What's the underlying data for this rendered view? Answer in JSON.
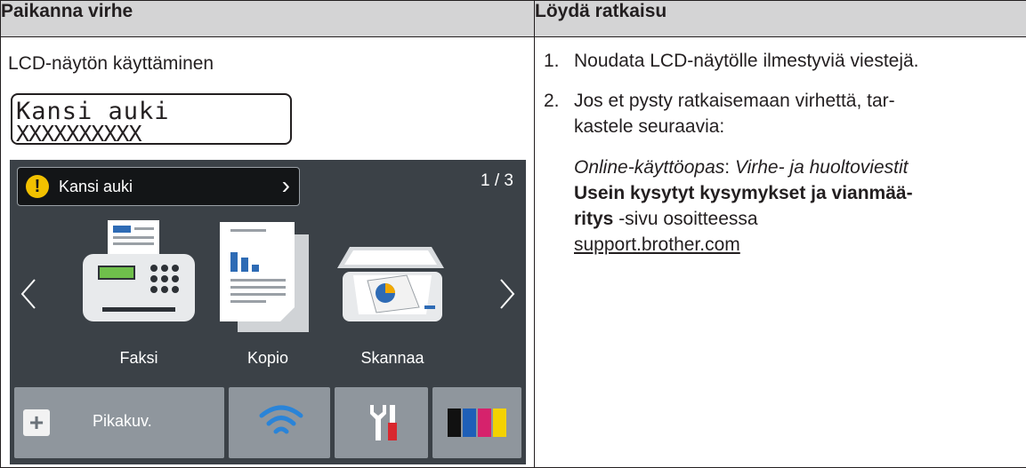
{
  "table": {
    "col_issue_header": "Paikanna virhe",
    "col_solution_header": "Löydä ratkaisu"
  },
  "issue": {
    "text": "LCD-näytön käyttäminen",
    "lcd_line1": "Kansi auki",
    "lcd_line2": "XXXXXXXXXX"
  },
  "screen": {
    "alert_text": "Kansi auki",
    "page_indicator": "1 / 3",
    "apps": [
      {
        "label": "Faksi",
        "icon": "fax-icon"
      },
      {
        "label": "Kopio",
        "icon": "copy-icon"
      },
      {
        "label": "Skannaa",
        "icon": "scan-icon"
      }
    ],
    "shortcut_label": "Pikakuv.",
    "colors": {
      "background": "#3b4147",
      "button": "#8f969d",
      "warning": "#f2c100"
    }
  },
  "solution": {
    "step1_num": "1.",
    "step1": "Noudata LCD-näytölle ilmestyviä viestejä.",
    "step2_num": "2.",
    "step2_line1": "Jos et pysty ratkaisemaan virhettä, tar-",
    "step2_line2": "kastele seuraavia:",
    "ref_italic_guide": "Online-käyttöopas",
    "ref_colon": ": ",
    "ref_italic_chapter": "Virhe- ja huoltoviestit",
    "ref_bold_line1": "Usein kysytyt kysymykset ja vianmää-",
    "ref_bold_line2": "ritys",
    "ref_suffix": " -sivu osoitteessa",
    "ref_link": "support.brother.com"
  }
}
